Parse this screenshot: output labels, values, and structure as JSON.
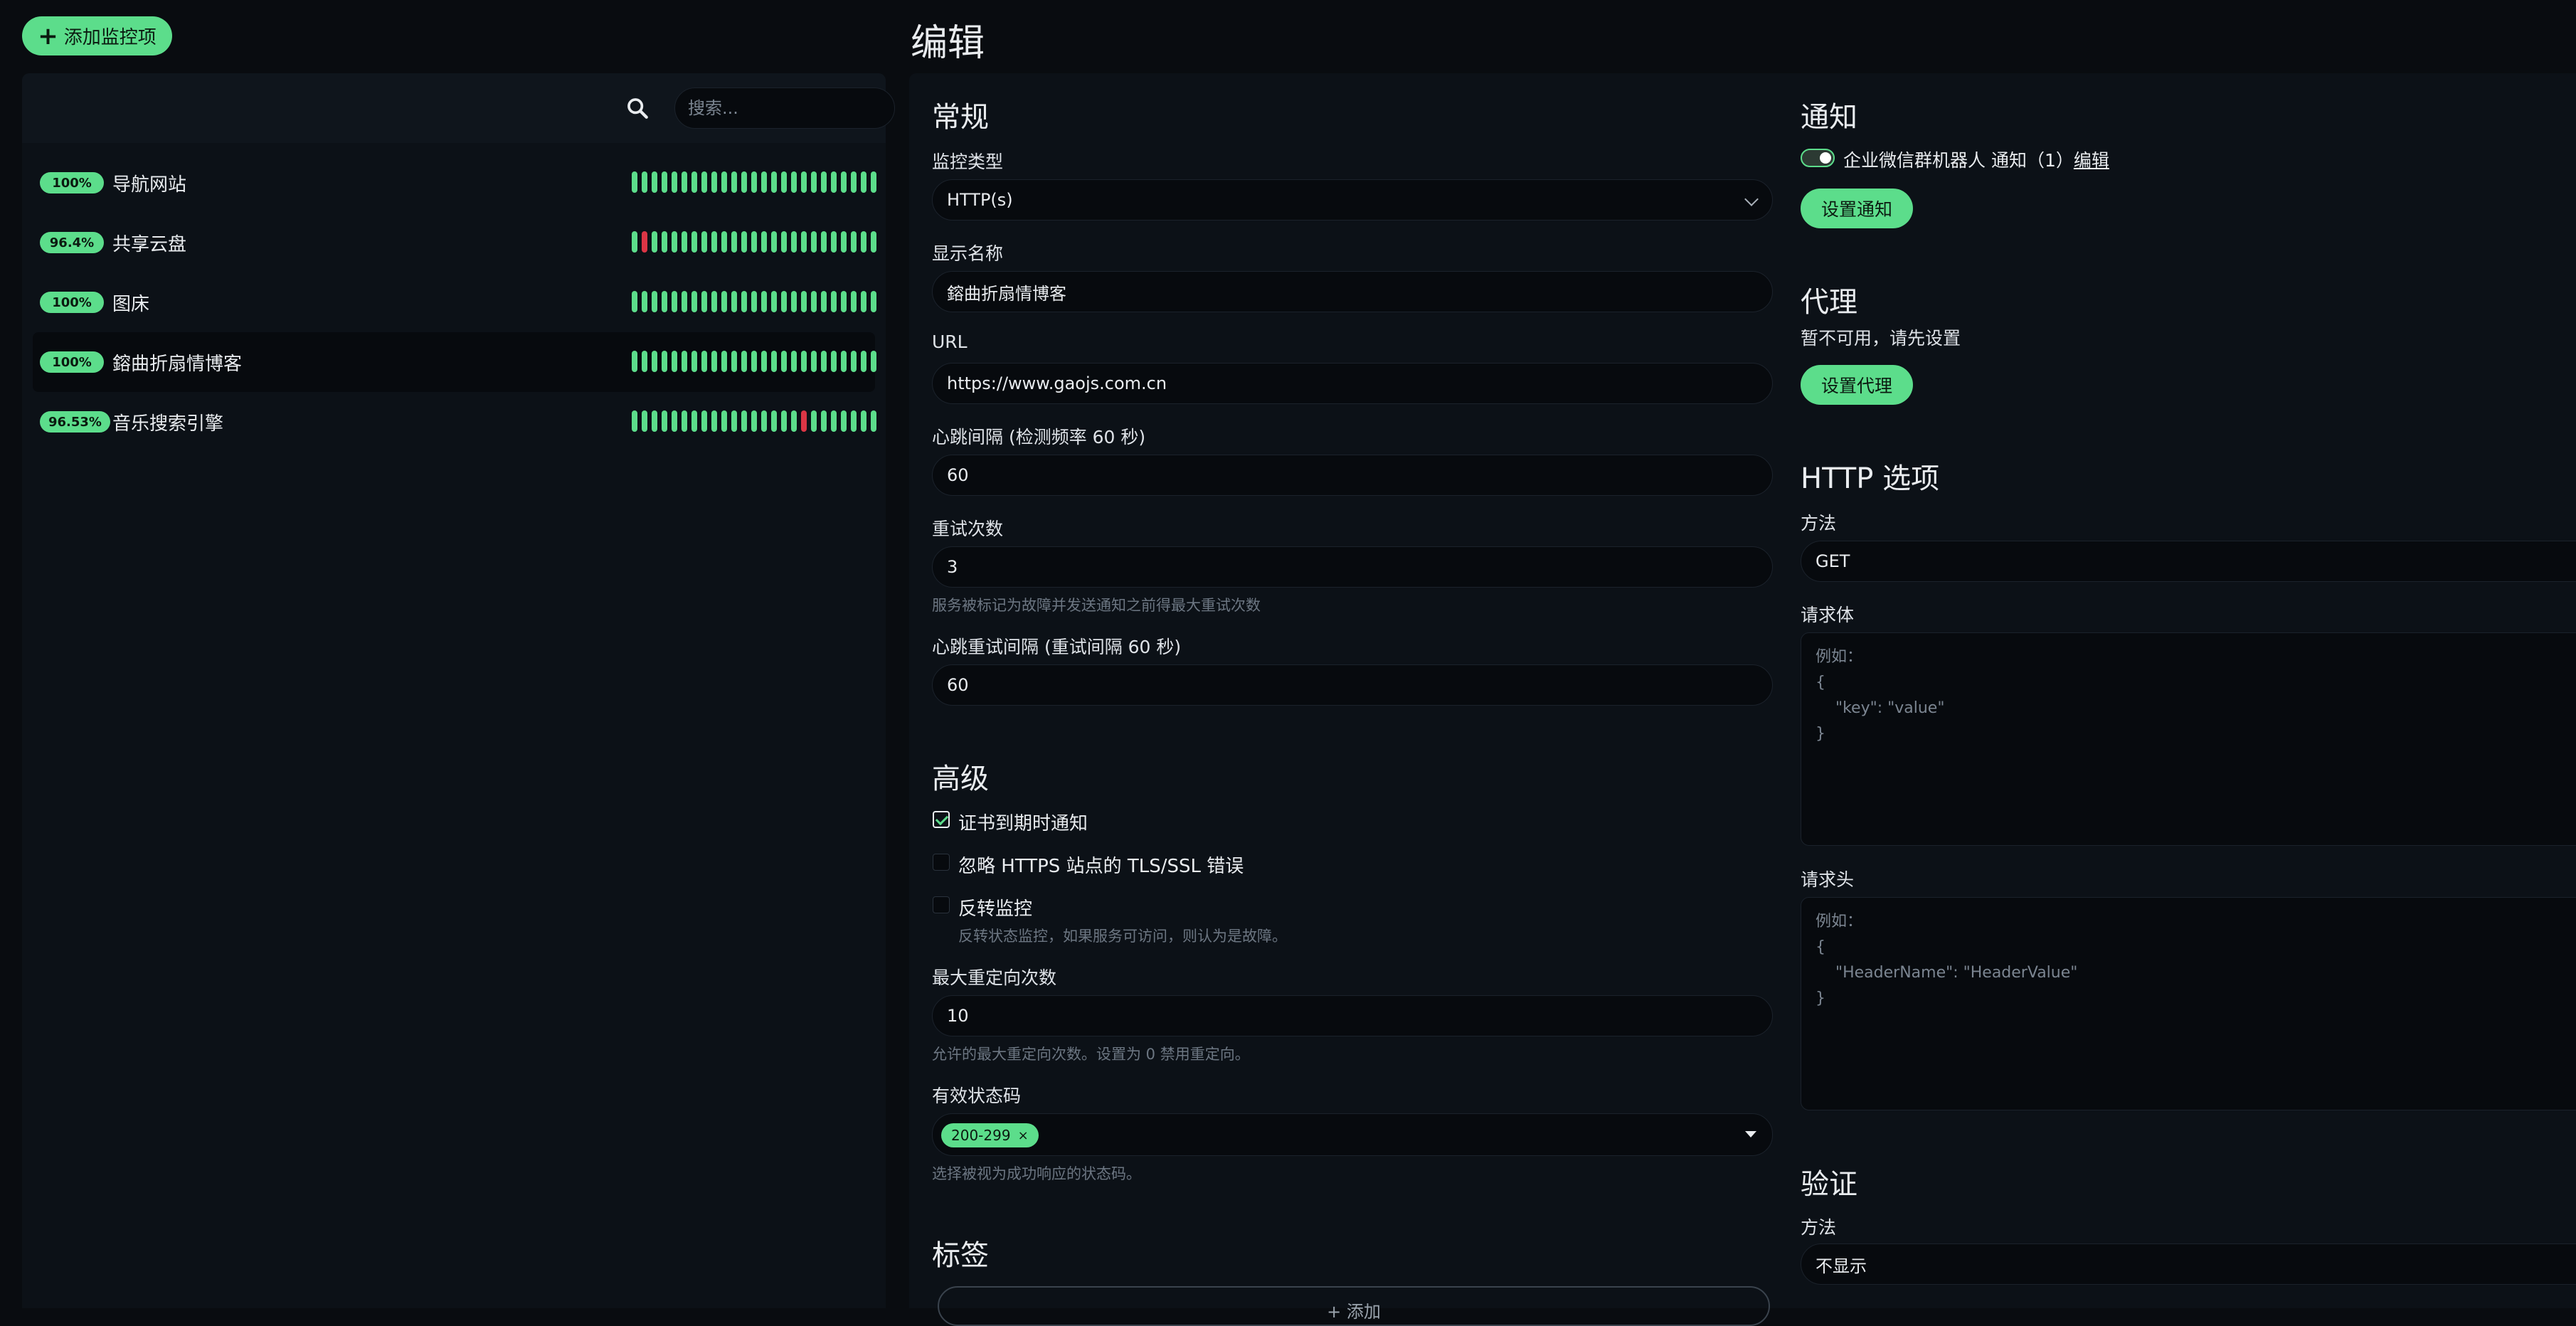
{
  "toolbar": {
    "add_monitor_label": "添加监控项"
  },
  "search": {
    "placeholder": "搜索..."
  },
  "monitors": [
    {
      "name": "导航网站",
      "uptime": "100%",
      "down_beats": []
    },
    {
      "name": "共享云盘",
      "uptime": "96.4%",
      "down_beats": [
        1
      ]
    },
    {
      "name": "图床",
      "uptime": "100%",
      "down_beats": []
    },
    {
      "name": "鎔曲折扇情博客",
      "uptime": "100%",
      "down_beats": []
    },
    {
      "name": "音乐搜索引擎",
      "uptime": "96.53%",
      "down_beats": [
        17
      ]
    }
  ],
  "edit": {
    "title": "编辑",
    "general": {
      "title": "常规",
      "monitor_type_label": "监控类型",
      "monitor_type_value": "HTTP(s)",
      "display_name_label": "显示名称",
      "display_name_value": "鎔曲折扇情博客",
      "url_label": "URL",
      "url_value": "https://www.gaojs.com.cn",
      "interval_label": "心跳间隔 (检测频率 60 秒)",
      "interval_value": "60",
      "retries_label": "重试次数",
      "retries_value": "3",
      "retries_hint": "服务被标记为故障并发送通知之前得最大重试次数",
      "retry_interval_label": "心跳重试间隔 (重试间隔 60 秒)",
      "retry_interval_value": "60"
    },
    "advanced": {
      "title": "高级",
      "cert_expiry_label": "证书到期时通知",
      "ignore_tls_label": "忽略 HTTPS 站点的 TLS/SSL 错误",
      "upside_down_label": "反转监控",
      "upside_down_hint": "反转状态监控，如果服务可访问，则认为是故障。",
      "max_redirects_label": "最大重定向次数",
      "max_redirects_value": "10",
      "max_redirects_hint": "允许的最大重定向次数。设置为 0 禁用重定向。",
      "accepted_codes_label": "有效状态码",
      "accepted_codes_chip": "200-299",
      "accepted_codes_hint": "选择被视为成功响应的状态码。"
    },
    "tags": {
      "title": "标签",
      "add_label": "+ 添加"
    },
    "notifications": {
      "title": "通知",
      "item_label": "企业微信群机器人 通知（1）",
      "edit_link": "编辑",
      "setup_button": "设置通知"
    },
    "proxy": {
      "title": "代理",
      "unavailable": "暂不可用，请先设置",
      "setup_button": "设置代理"
    },
    "http_options": {
      "title": "HTTP 选项",
      "method_label": "方法",
      "method_value": "GET",
      "body_label": "请求体",
      "body_placeholder": "例如：\n{\n    \"key\": \"value\"\n}",
      "headers_label": "请求头",
      "headers_placeholder": "例如：\n{\n    \"HeaderName\": \"HeaderValue\"\n}"
    },
    "auth": {
      "title": "验证",
      "method_label": "方法",
      "method_value": "不显示"
    }
  },
  "colors": {
    "accent": "#5cdd8b",
    "down": "#dc3545",
    "background": "#090c10",
    "panel": "#0c1117"
  }
}
